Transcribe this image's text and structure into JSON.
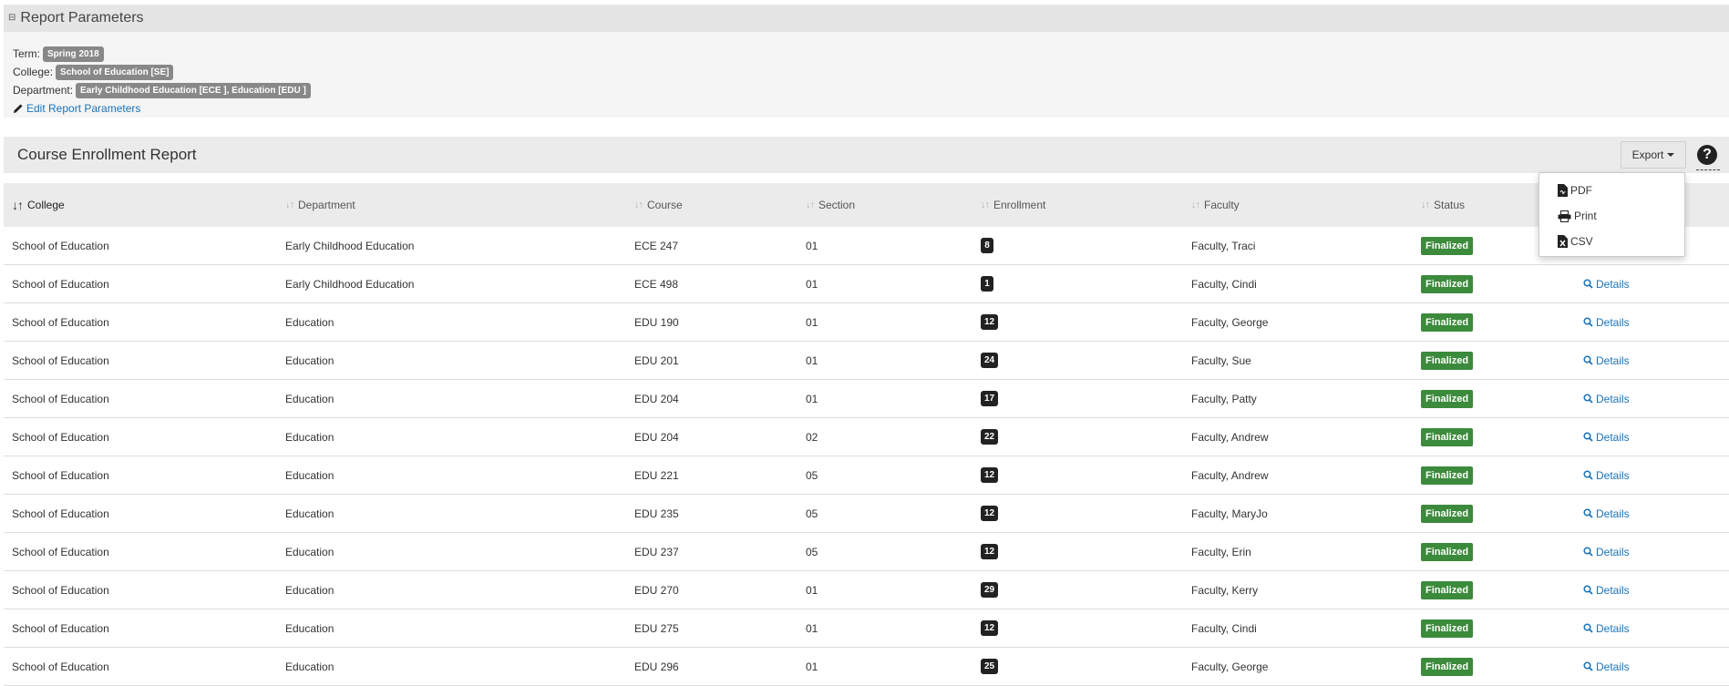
{
  "params": {
    "title": "Report Parameters",
    "term_label": "Term:",
    "term_value": "Spring 2018",
    "college_label": "College:",
    "college_value": "School of Education [SE]",
    "department_label": "Department:",
    "department_value": "Early Childhood Education [ECE ], Education [EDU ]",
    "edit_link": "Edit Report Parameters"
  },
  "report": {
    "title": "Course Enrollment Report",
    "export_label": "Export",
    "help_symbol": "?"
  },
  "export_menu": {
    "items": [
      {
        "label": "PDF",
        "icon": "file-pdf-icon"
      },
      {
        "label": "Print",
        "icon": "printer-icon"
      },
      {
        "label": "CSV",
        "icon": "file-csv-icon"
      }
    ]
  },
  "table": {
    "columns": [
      "College",
      "Department",
      "Course",
      "Section",
      "Enrollment",
      "Faculty",
      "Status"
    ],
    "sorted_column": "College",
    "details_label": "Details",
    "rows": [
      {
        "college": "School of Education",
        "department": "Early Childhood Education",
        "course": "ECE 247",
        "section": "01",
        "enrollment": "8",
        "faculty": "Faculty, Traci",
        "status": "Finalized"
      },
      {
        "college": "School of Education",
        "department": "Early Childhood Education",
        "course": "ECE 498",
        "section": "01",
        "enrollment": "1",
        "faculty": "Faculty, Cindi",
        "status": "Finalized"
      },
      {
        "college": "School of Education",
        "department": "Education",
        "course": "EDU 190",
        "section": "01",
        "enrollment": "12",
        "faculty": "Faculty, George",
        "status": "Finalized"
      },
      {
        "college": "School of Education",
        "department": "Education",
        "course": "EDU 201",
        "section": "01",
        "enrollment": "24",
        "faculty": "Faculty, Sue",
        "status": "Finalized"
      },
      {
        "college": "School of Education",
        "department": "Education",
        "course": "EDU 204",
        "section": "01",
        "enrollment": "17",
        "faculty": "Faculty, Patty",
        "status": "Finalized"
      },
      {
        "college": "School of Education",
        "department": "Education",
        "course": "EDU 204",
        "section": "02",
        "enrollment": "22",
        "faculty": "Faculty, Andrew",
        "status": "Finalized"
      },
      {
        "college": "School of Education",
        "department": "Education",
        "course": "EDU 221",
        "section": "05",
        "enrollment": "12",
        "faculty": "Faculty, Andrew",
        "status": "Finalized"
      },
      {
        "college": "School of Education",
        "department": "Education",
        "course": "EDU 235",
        "section": "05",
        "enrollment": "12",
        "faculty": "Faculty, MaryJo",
        "status": "Finalized"
      },
      {
        "college": "School of Education",
        "department": "Education",
        "course": "EDU 237",
        "section": "05",
        "enrollment": "12",
        "faculty": "Faculty, Erin",
        "status": "Finalized"
      },
      {
        "college": "School of Education",
        "department": "Education",
        "course": "EDU 270",
        "section": "01",
        "enrollment": "29",
        "faculty": "Faculty, Kerry",
        "status": "Finalized"
      },
      {
        "college": "School of Education",
        "department": "Education",
        "course": "EDU 275",
        "section": "01",
        "enrollment": "12",
        "faculty": "Faculty, Cindi",
        "status": "Finalized"
      },
      {
        "college": "School of Education",
        "department": "Education",
        "course": "EDU 296",
        "section": "01",
        "enrollment": "25",
        "faculty": "Faculty, George",
        "status": "Finalized"
      }
    ]
  },
  "colors": {
    "status_finalized": "#3c8a3c",
    "link": "#1a73b8",
    "tag_gray": "#888888",
    "count_badge": "#222222"
  }
}
